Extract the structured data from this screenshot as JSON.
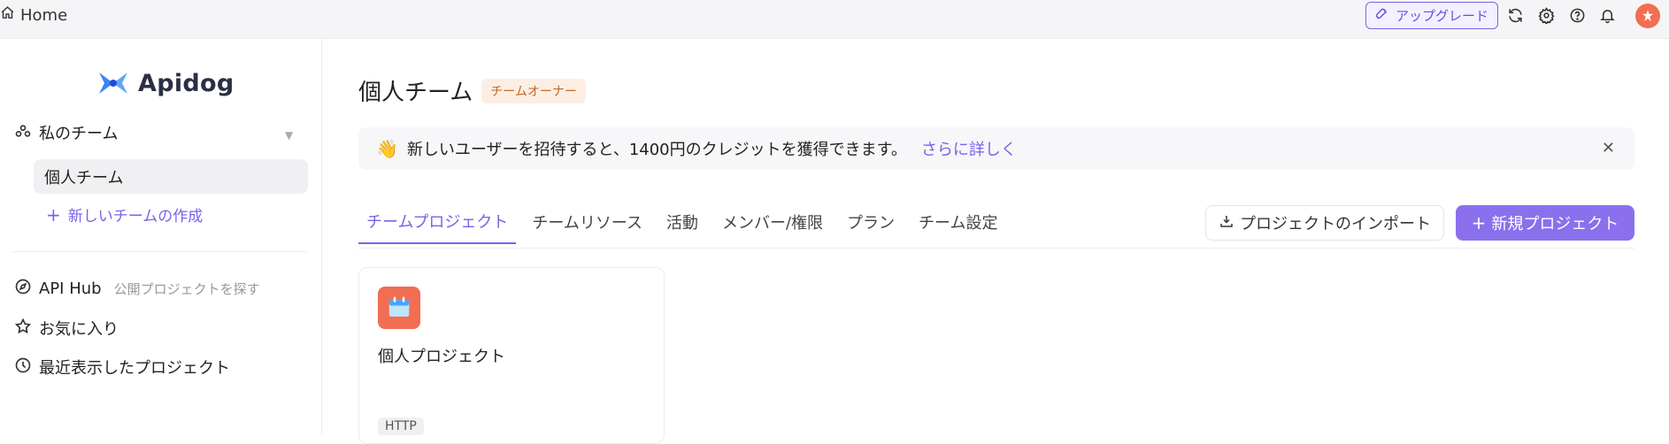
{
  "topbar": {
    "home_label": "Home",
    "upgrade_label": "アップグレード",
    "icons": [
      "refresh-icon",
      "gear-icon",
      "help-icon",
      "bell-icon"
    ]
  },
  "sidebar": {
    "logo_text": "Apidog",
    "my_teams_label": "私のチーム",
    "selected_team": "個人チーム",
    "new_team_label": "新しいチームの作成",
    "api_hub_label": "API Hub",
    "api_hub_sub": "公開プロジェクトを探す",
    "favorites_label": "お気に入り",
    "recent_label": "最近表示したプロジェクト"
  },
  "main": {
    "team_name": "個人チーム",
    "owner_badge": "チームオーナー",
    "banner": {
      "text": "新しいユーザーを招待すると、1400円のクレジットを獲得できます。",
      "link": "さらに詳しく"
    },
    "tabs": [
      {
        "label": "チームプロジェクト",
        "active": true
      },
      {
        "label": "チームリソース"
      },
      {
        "label": "活動"
      },
      {
        "label": "メンバー/権限"
      },
      {
        "label": "プラン"
      },
      {
        "label": "チーム設定"
      }
    ],
    "import_label": "プロジェクトのインポート",
    "new_project_label": "新規プロジェクト",
    "project_card": {
      "name": "個人プロジェクト",
      "tag": "HTTP"
    }
  },
  "colors": {
    "accent": "#7b61e8",
    "button_primary": "#8a70ec",
    "badge_bg": "#fdeee4",
    "badge_text": "#c4672b",
    "project_icon": "#f26e52"
  }
}
